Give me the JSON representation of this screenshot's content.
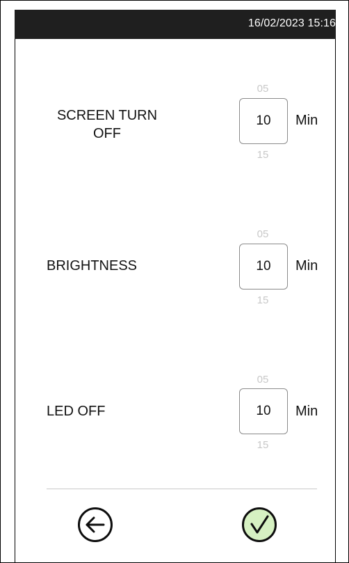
{
  "header": {
    "datetime": "16/02/2023 15:16"
  },
  "settings": [
    {
      "label_line1": "SCREEN TURN",
      "label_line2": "OFF",
      "prev": "05",
      "value": "10",
      "next": "15",
      "unit": "Min"
    },
    {
      "label": "BRIGHTNESS",
      "prev": "05",
      "value": "10",
      "next": "15",
      "unit": "Min"
    },
    {
      "label": "LED OFF",
      "prev": "05",
      "value": "10",
      "next": "15",
      "unit": "Min"
    }
  ],
  "footer": {
    "back_icon": "arrow-left-circle-icon",
    "confirm_icon": "check-circle-icon",
    "confirm_color": "#d6f1c2"
  }
}
